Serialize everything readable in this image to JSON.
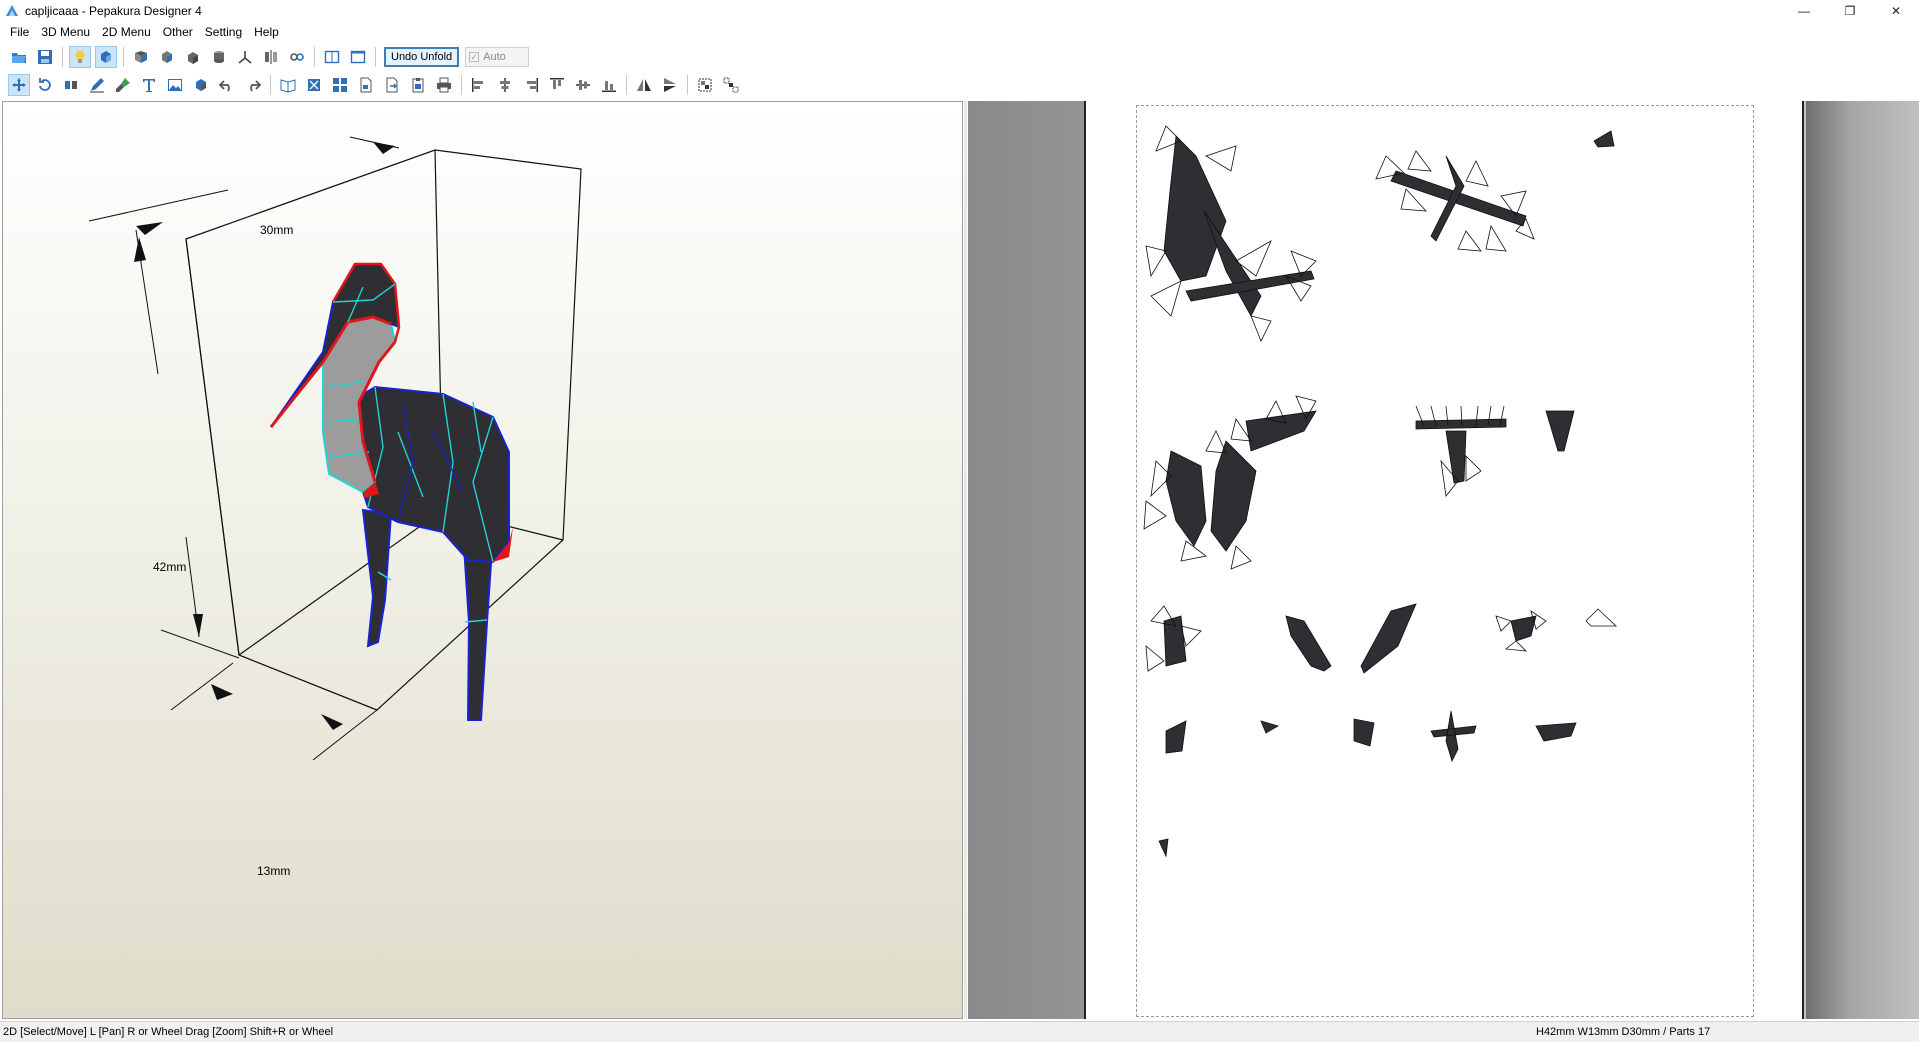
{
  "window": {
    "title": "capljicaaa - Pepakura Designer 4",
    "controls": {
      "minimize": "—",
      "restore": "❐",
      "close": "✕"
    }
  },
  "menu": {
    "items": [
      "File",
      "3D Menu",
      "2D Menu",
      "Other",
      "Setting",
      "Help"
    ]
  },
  "toolbar1": {
    "undo_unfold_label": "Undo Unfold",
    "auto_label": "Auto",
    "auto_checked": true
  },
  "view3d": {
    "dimensions": {
      "width": "30mm",
      "height": "42mm",
      "depth": "13mm"
    }
  },
  "status": {
    "left": "2D [Select/Move] L [Pan] R or Wheel Drag [Zoom] Shift+R or Wheel",
    "right": "H42mm W13mm D30mm / Parts 17"
  },
  "colors": {
    "edge_blue": "#1a22d6",
    "edge_cyan": "#21d3d8",
    "edge_red": "#e0161c",
    "body_dark": "#2e2e33",
    "neck_grey": "#9c9c9c",
    "toolbar_active": "#cce4f7"
  }
}
